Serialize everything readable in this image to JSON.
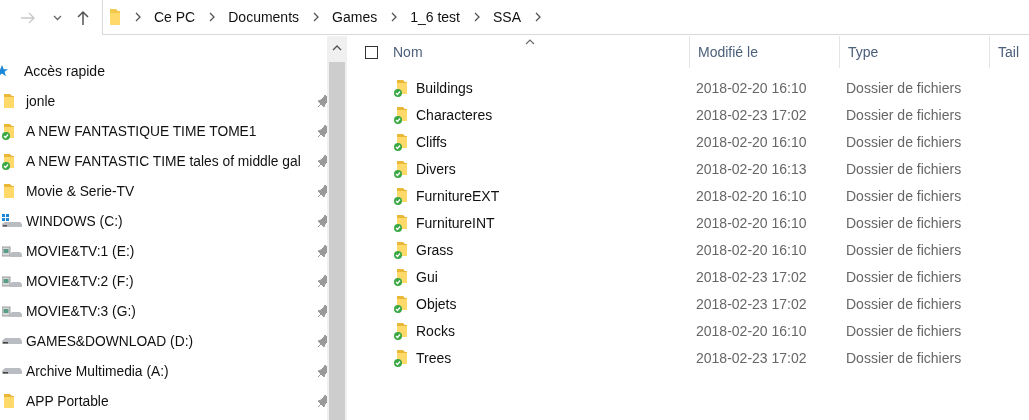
{
  "nav": {
    "forward_disabled": true
  },
  "breadcrumb": [
    "Ce PC",
    "Documents",
    "Games",
    "1_6 test",
    "SSA"
  ],
  "sidebar": {
    "header": "Accès rapide",
    "items": [
      {
        "label": "jonle",
        "kind": "folder",
        "pinned": true
      },
      {
        "label": "A NEW FANTASTIQUE TIME TOME1",
        "kind": "synced-folder",
        "pinned": true
      },
      {
        "label": "A NEW FANTASTIC TIME tales of middle gal",
        "kind": "synced-folder",
        "pinned": true
      },
      {
        "label": "Movie & Serie-TV",
        "kind": "folder",
        "pinned": true
      },
      {
        "label": "WINDOWS (C:)",
        "kind": "system-drive",
        "pinned": true
      },
      {
        "label": "MOVIE&TV:1 (E:)",
        "kind": "media-drive",
        "pinned": true
      },
      {
        "label": "MOVIE&TV:2 (F:)",
        "kind": "media-drive",
        "pinned": true
      },
      {
        "label": "MOVIE&TV:3 (G:)",
        "kind": "media-drive",
        "pinned": true
      },
      {
        "label": "GAMES&DOWNLOAD (D:)",
        "kind": "drive",
        "pinned": true
      },
      {
        "label": "Archive Multimedia (A:)",
        "kind": "drive",
        "pinned": true
      },
      {
        "label": "APP Portable",
        "kind": "folder",
        "pinned": true
      }
    ]
  },
  "table": {
    "select_all_checked": false,
    "columns": [
      "Nom",
      "Modifié le",
      "Type",
      "Tail"
    ],
    "rows": [
      {
        "name": "Buildings",
        "modified": "2018-02-20 16:10",
        "type": "Dossier de fichiers",
        "synced": true
      },
      {
        "name": "Characteres",
        "modified": "2018-02-23 17:02",
        "type": "Dossier de fichiers",
        "synced": true
      },
      {
        "name": "Cliffs",
        "modified": "2018-02-20 16:10",
        "type": "Dossier de fichiers",
        "synced": true
      },
      {
        "name": "Divers",
        "modified": "2018-02-20 16:13",
        "type": "Dossier de fichiers",
        "synced": true
      },
      {
        "name": "FurnitureEXT",
        "modified": "2018-02-20 16:10",
        "type": "Dossier de fichiers",
        "synced": true
      },
      {
        "name": "FurnitureINT",
        "modified": "2018-02-20 16:10",
        "type": "Dossier de fichiers",
        "synced": true
      },
      {
        "name": "Grass",
        "modified": "2018-02-20 16:10",
        "type": "Dossier de fichiers",
        "synced": true
      },
      {
        "name": "Gui",
        "modified": "2018-02-23 17:02",
        "type": "Dossier de fichiers",
        "synced": true
      },
      {
        "name": "Objets",
        "modified": "2018-02-23 17:02",
        "type": "Dossier de fichiers",
        "synced": true
      },
      {
        "name": "Rocks",
        "modified": "2018-02-20 16:10",
        "type": "Dossier de fichiers",
        "synced": true
      },
      {
        "name": "Trees",
        "modified": "2018-02-23 17:02",
        "type": "Dossier de fichiers",
        "synced": true
      }
    ]
  }
}
